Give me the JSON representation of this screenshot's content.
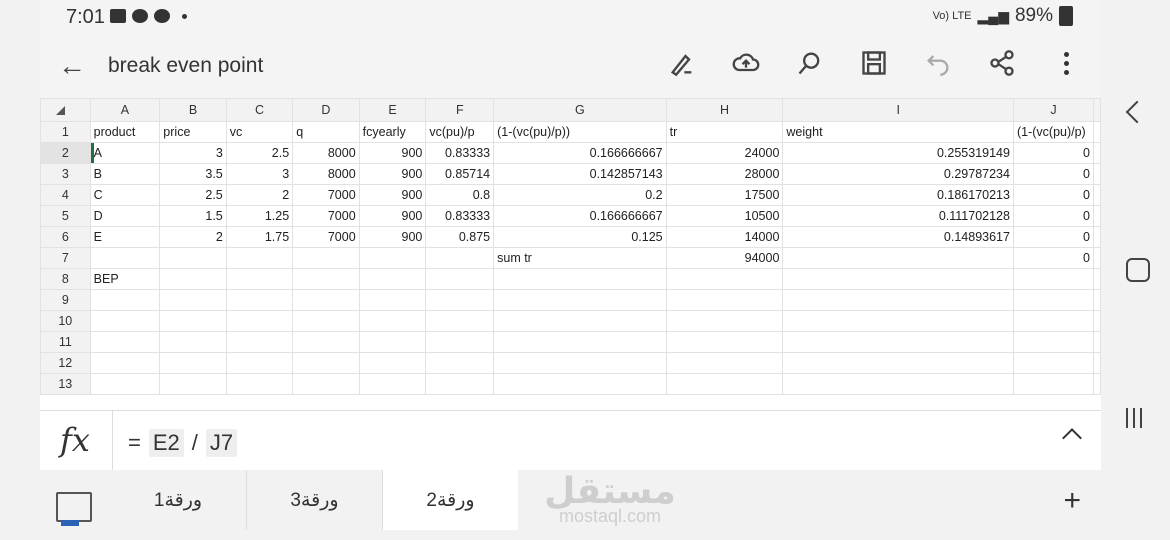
{
  "status": {
    "time": "7:01",
    "battery": "89%",
    "network": "Vo) LTE"
  },
  "app": {
    "title": "break even point"
  },
  "grid": {
    "columns": [
      "A",
      "B",
      "C",
      "D",
      "E",
      "F",
      "G",
      "H",
      "I",
      "J"
    ],
    "rows": [
      {
        "n": "1",
        "cells": [
          "product",
          "price",
          "vc",
          "q",
          "fcyearly",
          "vc(pu)/p",
          "(1-(vc(pu)/p))",
          "tr",
          "weight",
          "(1-(vc(pu)/p)"
        ]
      },
      {
        "n": "2",
        "cells": [
          "A",
          "3",
          "2.5",
          "8000",
          "900",
          "0.83333",
          "0.166666667",
          "24000",
          "0.255319149",
          "0"
        ]
      },
      {
        "n": "3",
        "cells": [
          "B",
          "3.5",
          "3",
          "8000",
          "900",
          "0.85714",
          "0.142857143",
          "28000",
          "0.29787234",
          "0"
        ]
      },
      {
        "n": "4",
        "cells": [
          "C",
          "2.5",
          "2",
          "7000",
          "900",
          "0.8",
          "0.2",
          "17500",
          "0.186170213",
          "0"
        ]
      },
      {
        "n": "5",
        "cells": [
          "D",
          "1.5",
          "1.25",
          "7000",
          "900",
          "0.83333",
          "0.166666667",
          "10500",
          "0.111702128",
          "0"
        ]
      },
      {
        "n": "6",
        "cells": [
          "E",
          "2",
          "1.75",
          "7000",
          "900",
          "0.875",
          "0.125",
          "14000",
          "0.14893617",
          "0"
        ]
      },
      {
        "n": "7",
        "cells": [
          "",
          "",
          "",
          "",
          "",
          "",
          "sum tr",
          "94000",
          "",
          "0"
        ]
      },
      {
        "n": "8",
        "cells": [
          "BEP",
          "",
          "",
          "",
          "",
          "",
          "",
          "",
          "",
          ""
        ]
      },
      {
        "n": "9",
        "cells": [
          "",
          "",
          "",
          "",
          "",
          "",
          "",
          "",
          "",
          ""
        ]
      },
      {
        "n": "10",
        "cells": [
          "",
          "",
          "",
          "",
          "",
          "",
          "",
          "",
          "",
          ""
        ]
      },
      {
        "n": "11",
        "cells": [
          "",
          "",
          "",
          "",
          "",
          "",
          "",
          "",
          "",
          ""
        ]
      },
      {
        "n": "12",
        "cells": [
          "",
          "",
          "",
          "",
          "",
          "",
          "",
          "",
          "",
          ""
        ]
      },
      {
        "n": "13",
        "cells": [
          "",
          "",
          "",
          "",
          "",
          "",
          "",
          "",
          "",
          ""
        ]
      }
    ]
  },
  "formula": {
    "fx": "fx",
    "eq": "=",
    "ref1": "E2",
    "op": "/",
    "ref2": "J7"
  },
  "sheets": {
    "tabs": [
      "ورقة1",
      "ورقة3",
      "ورقة2"
    ],
    "active_index": 2
  },
  "watermark": {
    "arabic": "مستقل",
    "latin": "mostaql.com"
  }
}
